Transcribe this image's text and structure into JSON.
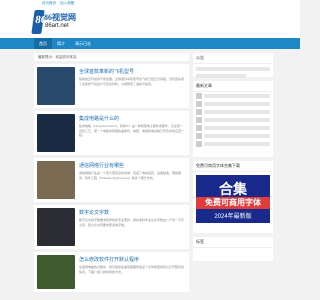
{
  "topbar": {
    "links": [
      "设为首页",
      "加入收藏"
    ]
  },
  "logo": {
    "mark": "86",
    "title": "86视觉网",
    "domain": "86art.net"
  },
  "nav": {
    "items": [
      "首页",
      "简介",
      "演示日志"
    ]
  },
  "notice": {
    "text": "最新提示：欢迎访问本站"
  },
  "articles": [
    {
      "title": "全球首款革新的飞机型号",
      "excerpt": "随着航空科技的不断发展，全球首款革新型号的飞机已经正式亮相，该机型采用了全新的气动设计与复合材料，大幅降低了油耗与噪音。",
      "thumb": "#2a4a6c"
    },
    {
      "title": "集成电路是什么的",
      "excerpt": "集成电路（Integrated Circuit，简称IC）是一种微型电子器件或部件，它采用一定的工艺，把一个电路中所需的晶体管、电阻、电容和电感等元件及布线互连一起。",
      "thumb": "#1c2b44"
    },
    {
      "title": "通信网络行业有哪些",
      "excerpt": "通信网络行业是一个庞大而复杂的领域，包括了电信运营、设备制造、网络服务、软件工程（Software Engineering）等多个细分方向。",
      "thumb": "#7a6a52"
    },
    {
      "title": "数字论文字数",
      "excerpt": "数字论文的字数要求因学校和专业而异，通常本科毕业论文字数在八千到一万字之间，硕士论文则要求更多的字数。",
      "thumb": "#2c2c34"
    },
    {
      "title": "怎么修改软件打开默认程序",
      "excerpt": "在使用电脑的过程中，我们经常会遇到需要修改某个文件类型的默认打开程序的情况，下面介绍几种常用的方法。",
      "thumb": "#3f5a2c"
    }
  ],
  "sidebar": {
    "search_title": "公告",
    "latest_title": "最新文章",
    "banner_title": "免费可商用字体合集下载",
    "banner": {
      "big": "合集",
      "mid": "免费可商用字体",
      "small": "2024年最新版"
    },
    "tag_title": "标签"
  },
  "colors": {
    "accent": "#1e88c7",
    "banner_bg": "#1a2a8c",
    "banner_red": "#e23b3b"
  }
}
